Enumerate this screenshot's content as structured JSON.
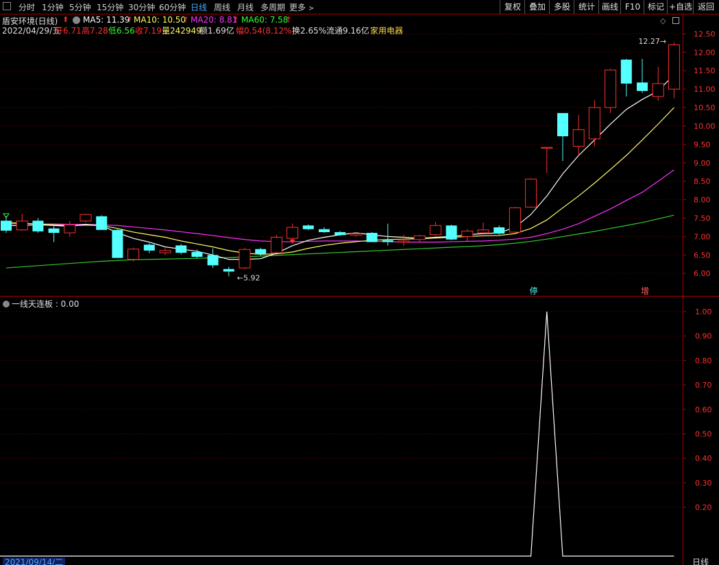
{
  "toolbar": {
    "periods": [
      "分时",
      "1分钟",
      "5分钟",
      "15分钟",
      "30分钟",
      "60分钟",
      "日线",
      "周线",
      "月线",
      "多周期",
      "更多"
    ],
    "active_period": "日线",
    "right_buttons": [
      "复权",
      "叠加",
      "多股",
      "统计",
      "画线",
      "F10",
      "标记",
      "+自选",
      "返回"
    ]
  },
  "header": {
    "stock_name": "盾安环境(日线)",
    "ma5": "MA5: 11.39",
    "ma10": "MA10: 10.50",
    "ma20": "MA20: 8.81",
    "ma60": "MA60: 7.58",
    "date": "2022/04/29/五",
    "open": "开6.71",
    "high": "高7.28",
    "low": "低6.56",
    "close": "收7.19",
    "volume": "量242949",
    "amount": "额1.69亿",
    "change": "幅0.54(8.12%)",
    "turnover": "换2.65%",
    "float": "流通9.16亿",
    "sector": "家用电器"
  },
  "colors": {
    "up": "#ff3232",
    "down": "#54ffff",
    "ma5": "#ffffff",
    "ma10": "#ffff66",
    "ma20": "#ff33ff",
    "ma60": "#33cc33",
    "grid": "#7a0000",
    "accent": "#4aa8ff"
  },
  "chart_data": [
    {
      "type": "candlestick",
      "y_ticks": [
        "12.50",
        "12.00",
        "11.50",
        "11.00",
        "10.50",
        "10.00",
        "9.50",
        "9.00",
        "8.50",
        "8.00",
        "7.50",
        "7.00",
        "6.50",
        "6.00"
      ],
      "ylim": [
        5.8,
        12.6
      ],
      "candles": [
        {
          "o": 7.43,
          "h": 7.55,
          "l": 7.1,
          "c": 7.16
        },
        {
          "o": 7.18,
          "h": 7.62,
          "l": 7.15,
          "c": 7.42
        },
        {
          "o": 7.43,
          "h": 7.5,
          "l": 7.1,
          "c": 7.14
        },
        {
          "o": 7.22,
          "h": 7.28,
          "l": 6.85,
          "c": 7.1
        },
        {
          "o": 7.1,
          "h": 7.42,
          "l": 7.0,
          "c": 7.32
        },
        {
          "o": 7.42,
          "h": 7.62,
          "l": 7.38,
          "c": 7.6
        },
        {
          "o": 7.55,
          "h": 7.58,
          "l": 7.25,
          "c": 7.18
        },
        {
          "o": 7.18,
          "h": 7.2,
          "l": 6.45,
          "c": 6.42
        },
        {
          "o": 6.38,
          "h": 6.7,
          "l": 6.32,
          "c": 6.66
        },
        {
          "o": 6.78,
          "h": 6.82,
          "l": 6.55,
          "c": 6.62
        },
        {
          "o": 6.56,
          "h": 6.68,
          "l": 6.5,
          "c": 6.62
        },
        {
          "o": 6.76,
          "h": 6.8,
          "l": 6.52,
          "c": 6.56
        },
        {
          "o": 6.58,
          "h": 6.65,
          "l": 6.42,
          "c": 6.45
        },
        {
          "o": 6.5,
          "h": 6.68,
          "l": 6.15,
          "c": 6.22
        },
        {
          "o": 6.12,
          "h": 6.18,
          "l": 5.92,
          "c": 6.05
        },
        {
          "o": 6.15,
          "h": 6.7,
          "l": 6.12,
          "c": 6.65
        },
        {
          "o": 6.66,
          "h": 6.7,
          "l": 6.48,
          "c": 6.52
        },
        {
          "o": 6.56,
          "h": 7.05,
          "l": 6.55,
          "c": 6.98
        },
        {
          "o": 6.95,
          "h": 7.35,
          "l": 6.9,
          "c": 7.25
        },
        {
          "o": 7.3,
          "h": 7.33,
          "l": 7.18,
          "c": 7.2
        },
        {
          "o": 7.2,
          "h": 7.25,
          "l": 7.1,
          "c": 7.12
        },
        {
          "o": 7.12,
          "h": 7.15,
          "l": 7.02,
          "c": 7.04
        },
        {
          "o": 7.04,
          "h": 7.1,
          "l": 7.0,
          "c": 7.08
        },
        {
          "o": 7.1,
          "h": 7.12,
          "l": 6.85,
          "c": 6.85
        },
        {
          "o": 6.9,
          "h": 7.35,
          "l": 6.75,
          "c": 6.85
        },
        {
          "o": 6.85,
          "h": 7.05,
          "l": 6.75,
          "c": 6.88
        },
        {
          "o": 6.92,
          "h": 7.05,
          "l": 6.85,
          "c": 7.02
        },
        {
          "o": 7.05,
          "h": 7.4,
          "l": 7.02,
          "c": 7.3
        },
        {
          "o": 7.3,
          "h": 7.32,
          "l": 6.9,
          "c": 6.92
        },
        {
          "o": 7.0,
          "h": 7.2,
          "l": 6.88,
          "c": 7.15
        },
        {
          "o": 7.1,
          "h": 7.38,
          "l": 7.05,
          "c": 7.18
        },
        {
          "o": 7.25,
          "h": 7.3,
          "l": 7.05,
          "c": 7.08
        },
        {
          "o": 7.12,
          "h": 7.8,
          "l": 7.1,
          "c": 7.78
        },
        {
          "o": 7.8,
          "h": 8.58,
          "l": 7.78,
          "c": 8.56
        },
        {
          "o": 9.42,
          "h": 9.42,
          "l": 8.72,
          "c": 9.42
        },
        {
          "o": 10.35,
          "h": 10.35,
          "l": 9.05,
          "c": 9.72
        },
        {
          "o": 9.45,
          "h": 10.3,
          "l": 9.2,
          "c": 9.9
        },
        {
          "o": 9.65,
          "h": 10.7,
          "l": 9.45,
          "c": 10.5
        },
        {
          "o": 10.5,
          "h": 11.55,
          "l": 10.35,
          "c": 11.52
        },
        {
          "o": 11.8,
          "h": 11.82,
          "l": 10.8,
          "c": 11.15
        },
        {
          "o": 11.18,
          "h": 11.82,
          "l": 10.9,
          "c": 10.95
        },
        {
          "o": 10.8,
          "h": 11.6,
          "l": 10.68,
          "c": 11.15
        },
        {
          "o": 11.0,
          "h": 12.27,
          "l": 10.75,
          "c": 12.2
        }
      ],
      "ma5": [
        7.3,
        7.3,
        7.32,
        7.3,
        7.28,
        7.33,
        7.3,
        7.1,
        6.95,
        6.85,
        6.72,
        6.66,
        6.6,
        6.5,
        6.38,
        6.38,
        6.4,
        6.55,
        6.75,
        6.9,
        6.98,
        7.05,
        7.1,
        7.05,
        7.0,
        6.98,
        6.95,
        6.98,
        7.0,
        7.05,
        7.08,
        7.1,
        7.25,
        7.6,
        8.1,
        8.7,
        9.2,
        9.62,
        10.05,
        10.45,
        10.72,
        10.95,
        11.39
      ],
      "ma10": [
        7.38,
        7.36,
        7.34,
        7.32,
        7.3,
        7.31,
        7.3,
        7.22,
        7.12,
        7.05,
        6.98,
        6.88,
        6.8,
        6.72,
        6.62,
        6.55,
        6.52,
        6.53,
        6.58,
        6.68,
        6.76,
        6.82,
        6.86,
        6.9,
        6.92,
        6.93,
        6.94,
        6.96,
        6.98,
        7.0,
        7.02,
        7.03,
        7.08,
        7.22,
        7.45,
        7.78,
        8.1,
        8.45,
        8.82,
        9.2,
        9.62,
        10.05,
        10.5
      ],
      "ma20": [
        7.35,
        7.35,
        7.34,
        7.34,
        7.33,
        7.33,
        7.32,
        7.3,
        7.26,
        7.22,
        7.18,
        7.13,
        7.08,
        7.03,
        6.97,
        6.92,
        6.88,
        6.86,
        6.86,
        6.87,
        6.88,
        6.88,
        6.88,
        6.87,
        6.86,
        6.85,
        6.85,
        6.85,
        6.86,
        6.87,
        6.88,
        6.9,
        6.93,
        6.98,
        7.08,
        7.2,
        7.35,
        7.55,
        7.75,
        7.98,
        8.2,
        8.5,
        8.81
      ],
      "ma60": [
        6.15,
        6.18,
        6.21,
        6.24,
        6.27,
        6.3,
        6.33,
        6.35,
        6.37,
        6.38,
        6.39,
        6.4,
        6.41,
        6.42,
        6.43,
        6.45,
        6.47,
        6.49,
        6.51,
        6.53,
        6.55,
        6.57,
        6.59,
        6.61,
        6.63,
        6.65,
        6.67,
        6.69,
        6.71,
        6.73,
        6.75,
        6.78,
        6.82,
        6.87,
        6.93,
        7.0,
        7.07,
        7.14,
        7.22,
        7.3,
        7.38,
        7.48,
        7.58
      ],
      "annotations": {
        "low_label": "5.92",
        "high_label": "12.27",
        "marker_a": "停",
        "marker_b": "增"
      }
    },
    {
      "type": "line",
      "title": "一线天连板 : 0.00",
      "y_ticks": [
        "1.00",
        "0.90",
        "0.80",
        "0.70",
        "0.60",
        "0.50",
        "0.40",
        "0.30",
        "0.20"
      ],
      "ylim": [
        0,
        1
      ],
      "values": [
        0,
        0,
        0,
        0,
        0,
        0,
        0,
        0,
        0,
        0,
        0,
        0,
        0,
        0,
        0,
        0,
        0,
        0,
        0,
        0,
        0,
        0,
        0,
        0,
        0,
        0,
        0,
        0,
        0,
        0,
        0,
        0,
        0,
        0,
        1,
        0,
        0,
        0,
        0,
        0,
        0,
        0,
        0
      ]
    }
  ],
  "footer": {
    "date_label": "2021/09/14/二",
    "period_label": "日线"
  }
}
